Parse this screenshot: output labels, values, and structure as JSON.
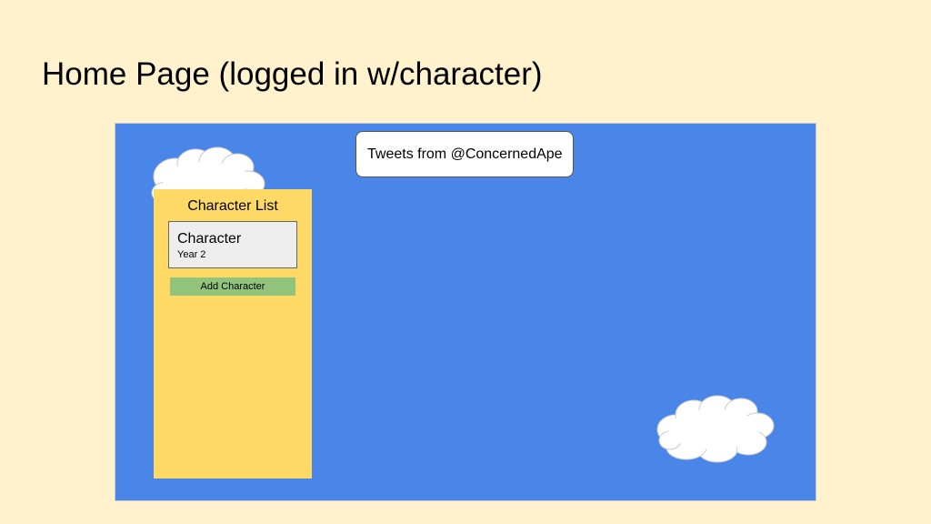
{
  "slide": {
    "title": "Home Page (logged in w/character)"
  },
  "tweets": {
    "label": "Tweets from @ConcernedApe"
  },
  "character_list": {
    "title": "Character List",
    "characters": [
      {
        "name": "Character",
        "detail": "Year 2"
      }
    ],
    "add_button_label": "Add Character"
  },
  "colors": {
    "background": "#fff2cc",
    "canvas": "#4a86e8",
    "panel": "#ffd966",
    "card": "#eeeeee",
    "add_button": "#93c47d",
    "cloud": "#ffffff"
  },
  "icons": [
    "cloud-icon"
  ]
}
